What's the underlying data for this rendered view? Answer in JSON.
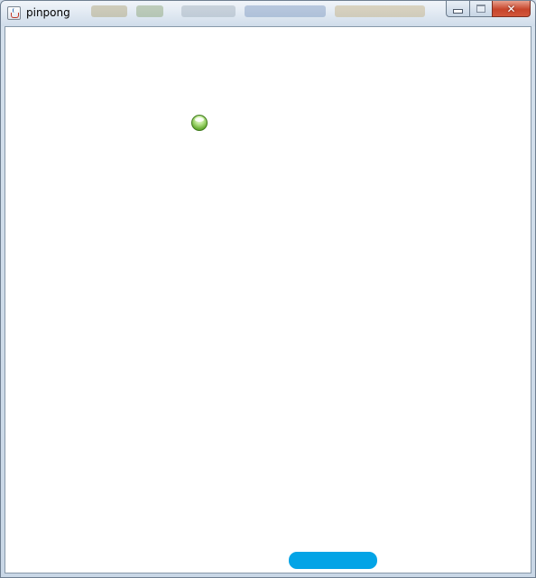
{
  "window": {
    "title": "pinpong",
    "controls": {
      "minimize_icon": "minimize-icon",
      "maximize_icon": "maximize-icon",
      "close_icon": "close-icon",
      "close_glyph": "✕"
    }
  },
  "game": {
    "background_color": "#ffffff",
    "ball": {
      "color": "#6fb33a",
      "icon": "green-ball"
    },
    "paddle": {
      "color": "#03a4e6"
    }
  }
}
